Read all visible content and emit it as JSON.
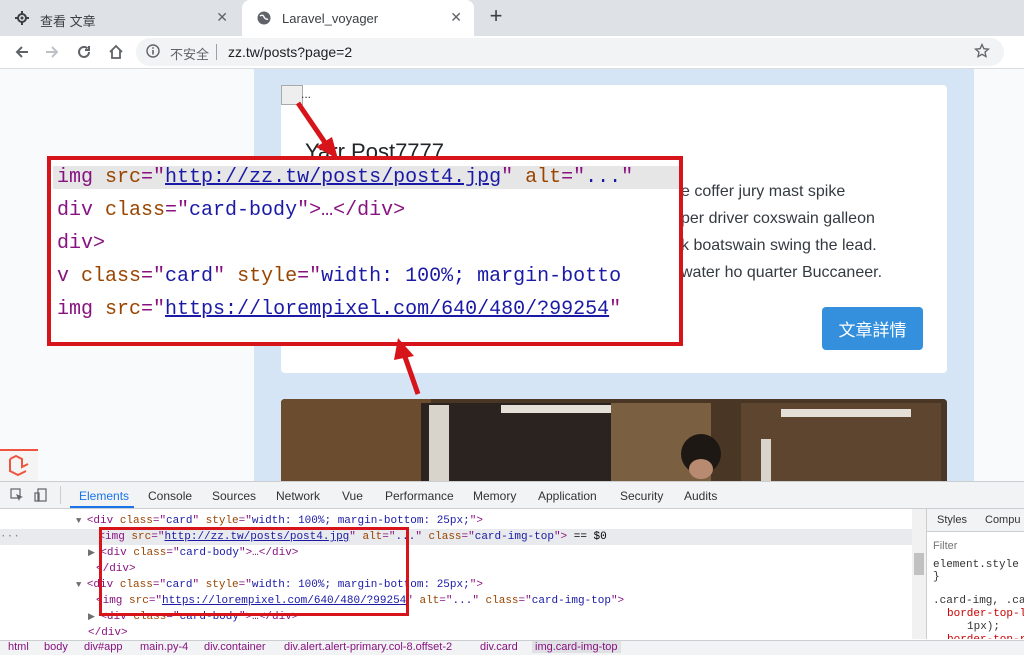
{
  "browser": {
    "tabs": [
      {
        "title": "查看 文章",
        "active": false
      },
      {
        "title": "Laravel_voyager",
        "active": true
      }
    ],
    "address": {
      "security_label": "不安全",
      "url": "zz.tw/posts?page=2"
    }
  },
  "page": {
    "card": {
      "img_alt": "...",
      "title": "Yarr Post7777",
      "text_lines": [
        "e coffer jury mast spike",
        "per driver coxswain galleon",
        "k boatswain swing the lead.",
        "water ho quarter Buccaneer."
      ],
      "button_label": "文章詳情"
    }
  },
  "callout": {
    "lines": [
      {
        "parts": [
          [
            "tag",
            "img "
          ],
          [
            "attr",
            "src"
          ],
          [
            "tag",
            "=\""
          ],
          [
            "link",
            "http://zz.tw/posts/post4.jpg"
          ],
          [
            "tag",
            "\" "
          ],
          [
            "attr",
            "alt"
          ],
          [
            "tag",
            "=\""
          ],
          [
            "val",
            "..."
          ],
          [
            "tag",
            "\""
          ]
        ]
      },
      {
        "parts": [
          [
            "tag",
            "div "
          ],
          [
            "attr",
            "class"
          ],
          [
            "tag",
            "=\""
          ],
          [
            "val",
            "card-body"
          ],
          [
            "tag",
            "\">…</div>"
          ]
        ]
      },
      {
        "parts": [
          [
            "tag",
            "div>"
          ]
        ]
      },
      {
        "parts": [
          [
            "tag",
            "v "
          ],
          [
            "attr",
            "class"
          ],
          [
            "tag",
            "=\""
          ],
          [
            "val",
            "card"
          ],
          [
            "tag",
            "\" "
          ],
          [
            "attr",
            "style"
          ],
          [
            "tag",
            "=\""
          ],
          [
            "val",
            "width: 100%; margin-botto"
          ]
        ]
      },
      {
        "parts": [
          [
            "tag",
            "img "
          ],
          [
            "attr",
            "src"
          ],
          [
            "tag",
            "=\""
          ],
          [
            "link",
            "https://lorempixel.com/640/480/?99254"
          ],
          [
            "tag",
            "\""
          ]
        ]
      }
    ]
  },
  "devtools": {
    "tabs": [
      "Elements",
      "Console",
      "Sources",
      "Network",
      "Vue",
      "Performance",
      "Memory",
      "Application",
      "Security",
      "Audits"
    ],
    "active_tab": "Elements",
    "element_lines": [
      {
        "prefix": "▼",
        "parts": [
          [
            "tag",
            "<div "
          ],
          [
            "attr",
            "class"
          ],
          [
            "tag",
            "=\""
          ],
          [
            "val",
            "card"
          ],
          [
            "tag",
            "\" "
          ],
          [
            "attr",
            "style"
          ],
          [
            "tag",
            "=\""
          ],
          [
            "val",
            "width: 100%; margin-bottom: 25px;"
          ],
          [
            "tag",
            "\">"
          ]
        ]
      },
      {
        "prefix": "",
        "parts": [
          [
            "tag",
            "<img "
          ],
          [
            "attr",
            "src"
          ],
          [
            "tag",
            "=\""
          ],
          [
            "link",
            "http://zz.tw/posts/post4.jpg"
          ],
          [
            "tag",
            "\" "
          ],
          [
            "attr",
            "alt"
          ],
          [
            "tag",
            "=\""
          ],
          [
            "val",
            "..."
          ],
          [
            "tag",
            "\" "
          ],
          [
            "attr",
            "class"
          ],
          [
            "tag",
            "=\""
          ],
          [
            "val",
            "card-img-top"
          ],
          [
            "tag",
            "\">"
          ],
          [
            "plain",
            " == $0"
          ]
        ]
      },
      {
        "prefix": "▶",
        "parts": [
          [
            "tag",
            "<div "
          ],
          [
            "attr",
            "class"
          ],
          [
            "tag",
            "=\""
          ],
          [
            "val",
            "card-body"
          ],
          [
            "tag",
            "\">…</div>"
          ]
        ]
      },
      {
        "prefix": "",
        "parts": [
          [
            "tag",
            "</div>"
          ]
        ]
      },
      {
        "prefix": "▼",
        "parts": [
          [
            "tag",
            "<div "
          ],
          [
            "attr",
            "class"
          ],
          [
            "tag",
            "=\""
          ],
          [
            "val",
            "card"
          ],
          [
            "tag",
            "\" "
          ],
          [
            "attr",
            "style"
          ],
          [
            "tag",
            "=\""
          ],
          [
            "val",
            "width: 100%; margin-bottom: 25px;"
          ],
          [
            "tag",
            "\">"
          ]
        ]
      },
      {
        "prefix": "",
        "parts": [
          [
            "tag",
            "<img "
          ],
          [
            "attr",
            "src"
          ],
          [
            "tag",
            "=\""
          ],
          [
            "link",
            "https://lorempixel.com/640/480/?99254"
          ],
          [
            "tag",
            "\" "
          ],
          [
            "attr",
            "alt"
          ],
          [
            "tag",
            "=\""
          ],
          [
            "val",
            "..."
          ],
          [
            "tag",
            "\" "
          ],
          [
            "attr",
            "class"
          ],
          [
            "tag",
            "=\""
          ],
          [
            "val",
            "card-img-top"
          ],
          [
            "tag",
            "\">"
          ]
        ]
      },
      {
        "prefix": "▶",
        "parts": [
          [
            "tag",
            "<div "
          ],
          [
            "attr",
            "class"
          ],
          [
            "tag",
            "=\""
          ],
          [
            "val",
            "card-body"
          ],
          [
            "tag",
            "\">…</div>"
          ]
        ]
      },
      {
        "prefix": "",
        "parts": [
          [
            "tag",
            "</div>"
          ]
        ]
      }
    ],
    "styles": {
      "tabs": [
        "Styles",
        "Compu"
      ],
      "filter_placeholder": "Filter",
      "lines": [
        "element.style {",
        "}",
        ".card-img, .car",
        "border-top-l",
        "1px);",
        "border-top-r"
      ]
    },
    "breadcrumbs": [
      "html",
      "body",
      "div#app",
      "main.py-4",
      "div.container",
      "div.alert.alert-primary.col-8.offset-2",
      "div.card",
      "img.card-img-top"
    ]
  },
  "colors": {
    "accent": "#3490dc",
    "highlight_red": "#d7141a"
  }
}
